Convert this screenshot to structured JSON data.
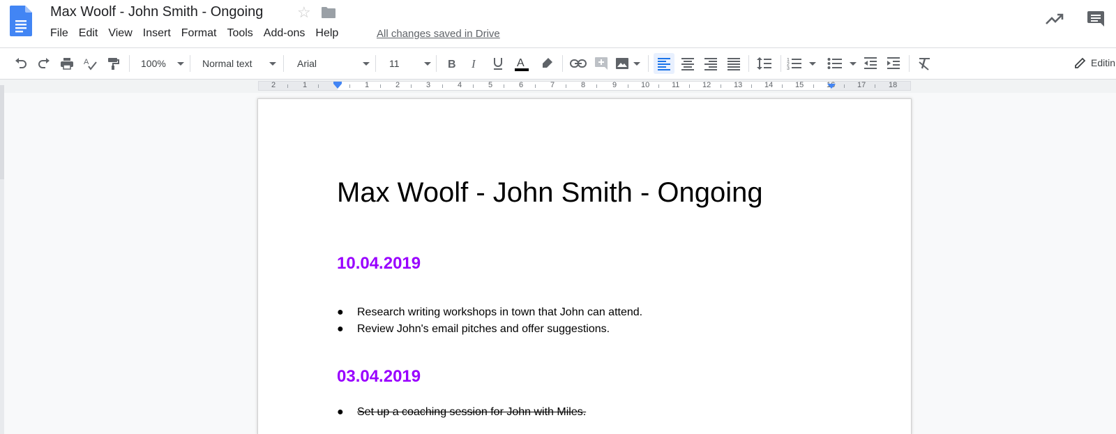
{
  "document": {
    "title": "Max Woolf - John Smith - Ongoing",
    "save_status": "All changes saved in Drive"
  },
  "menu": [
    "File",
    "Edit",
    "View",
    "Insert",
    "Format",
    "Tools",
    "Add-ons",
    "Help"
  ],
  "toolbar": {
    "zoom": "100%",
    "style": "Normal text",
    "font": "Arial",
    "font_size": "11",
    "mode_label": "Editin"
  },
  "ruler": {
    "labels": [
      "2",
      "1",
      "1",
      "2",
      "3",
      "4",
      "5",
      "6",
      "7",
      "8",
      "9",
      "10",
      "11",
      "12",
      "13",
      "14",
      "15",
      "16",
      "17",
      "18"
    ]
  },
  "content": {
    "title": "Max Woolf - John Smith - Ongoing",
    "sections": [
      {
        "date": "10.04.2019",
        "items": [
          {
            "text": "Research writing workshops in town that John can attend.",
            "done": false
          },
          {
            "text": "Review John's email pitches and offer suggestions.",
            "done": false
          }
        ]
      },
      {
        "date": "03.04.2019",
        "items": [
          {
            "text": "Set up a coaching session for John with Miles.",
            "done": true
          }
        ]
      }
    ]
  },
  "colors": {
    "heading": "#9900ff",
    "accent": "#4285f4"
  },
  "icons": [
    "docs-logo-icon",
    "star-icon",
    "folder-icon",
    "trending-icon",
    "comment-icon",
    "undo-icon",
    "redo-icon",
    "print-icon",
    "spellcheck-icon",
    "paint-format-icon",
    "bold-icon",
    "italic-icon",
    "underline-icon",
    "text-color-icon",
    "highlight-icon",
    "link-icon",
    "add-comment-icon",
    "image-icon",
    "align-left-icon",
    "align-center-icon",
    "align-right-icon",
    "justify-icon",
    "line-spacing-icon",
    "numbered-list-icon",
    "bulleted-list-icon",
    "decrease-indent-icon",
    "increase-indent-icon",
    "clear-format-icon",
    "pencil-icon"
  ]
}
